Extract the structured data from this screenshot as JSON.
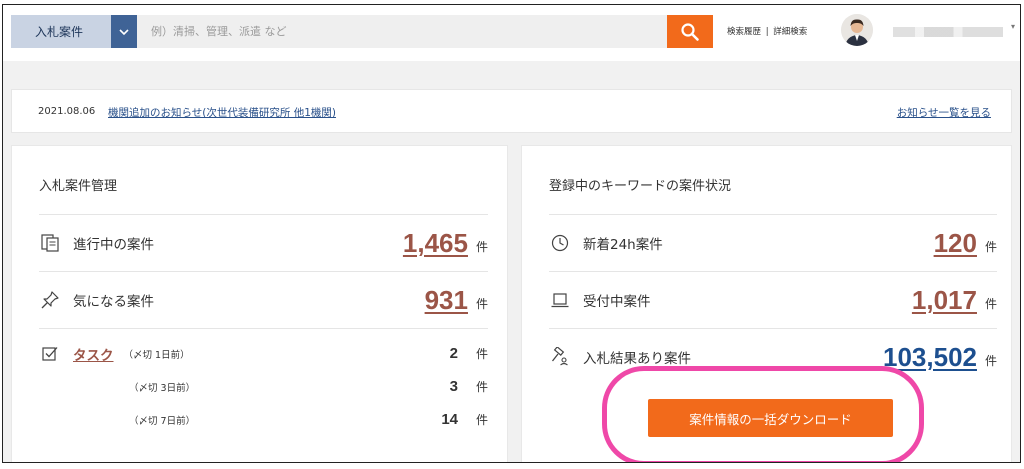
{
  "header": {
    "category_label": "入札案件",
    "search_placeholder": "例）清掃、管理、派遣 など",
    "history_link": "検索履歴",
    "separator": "|",
    "advanced_link": "詳細検索"
  },
  "notice": {
    "date": "2021.08.06",
    "link": "機関追加のお知らせ(次世代装備研究所 他1機関)",
    "view_all": "お知らせ一覧を見る"
  },
  "left_card": {
    "title": "入札案件管理",
    "rows": [
      {
        "label": "進行中の案件",
        "count": "1,465",
        "unit": "件"
      },
      {
        "label": "気になる案件",
        "count": "931",
        "unit": "件"
      }
    ],
    "task": {
      "label": "タスク",
      "items": [
        {
          "deadline": "（〆切 1日前）",
          "count": "2",
          "unit": "件"
        },
        {
          "deadline": "（〆切 3日前）",
          "count": "3",
          "unit": "件"
        },
        {
          "deadline": "（〆切 7日前）",
          "count": "14",
          "unit": "件"
        }
      ]
    }
  },
  "right_card": {
    "title": "登録中のキーワードの案件状況",
    "rows": [
      {
        "label": "新着24h案件",
        "count": "120",
        "unit": "件"
      },
      {
        "label": "受付中案件",
        "count": "1,017",
        "unit": "件"
      },
      {
        "label": "入札結果あり案件",
        "count": "103,502",
        "unit": "件"
      }
    ],
    "download_label": "案件情報の一括ダウンロード"
  },
  "colors": {
    "accent_orange": "#f26a1b",
    "highlight_pink": "#ef48a8",
    "count_brown": "#9b5547",
    "count_blue": "#1d4f8f"
  }
}
